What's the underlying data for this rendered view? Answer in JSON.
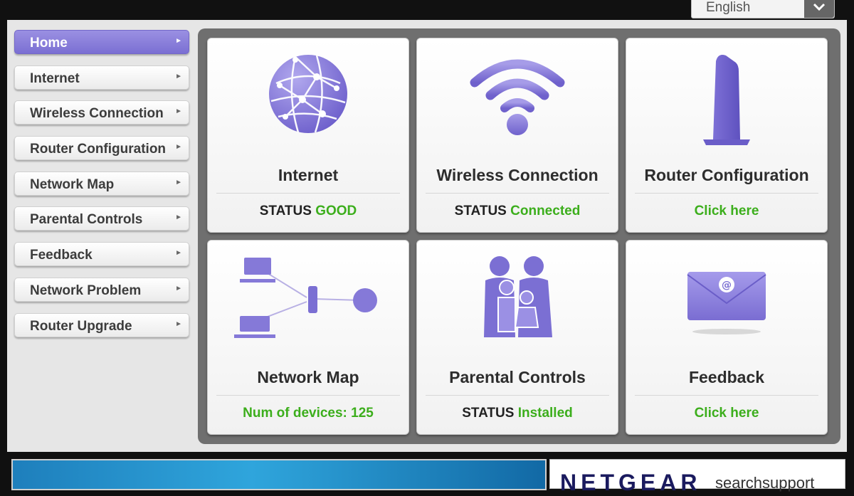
{
  "language": {
    "selected": "English"
  },
  "sidebar": {
    "items": [
      {
        "label": "Home",
        "active": true
      },
      {
        "label": "Internet"
      },
      {
        "label": "Wireless Connection"
      },
      {
        "label": "Router Configuration"
      },
      {
        "label": "Network Map"
      },
      {
        "label": "Parental Controls"
      },
      {
        "label": "Feedback"
      },
      {
        "label": "Network Problem"
      },
      {
        "label": "Router Upgrade"
      }
    ]
  },
  "cards": [
    {
      "title": "Internet",
      "status_label": "STATUS",
      "status_value": "GOOD",
      "icon": "globe-icon"
    },
    {
      "title": "Wireless Connection",
      "status_label": "STATUS",
      "status_value": "Connected",
      "icon": "wifi-icon"
    },
    {
      "title": "Router Configuration",
      "status_value": "Click here",
      "icon": "router-icon"
    },
    {
      "title": "Network Map",
      "status_value": "Num of devices: 125",
      "icon": "network-map-icon"
    },
    {
      "title": "Parental Controls",
      "status_label": "STATUS",
      "status_value": "Installed",
      "icon": "family-icon"
    },
    {
      "title": "Feedback",
      "status_value": "Click here",
      "icon": "envelope-icon"
    }
  ],
  "footer": {
    "brand": "NETGEAR",
    "brand_suffix": "searchsupport"
  },
  "colors": {
    "accent": "#8579d8",
    "status_good": "#3cae1c",
    "panel": "#6f6f6f"
  }
}
